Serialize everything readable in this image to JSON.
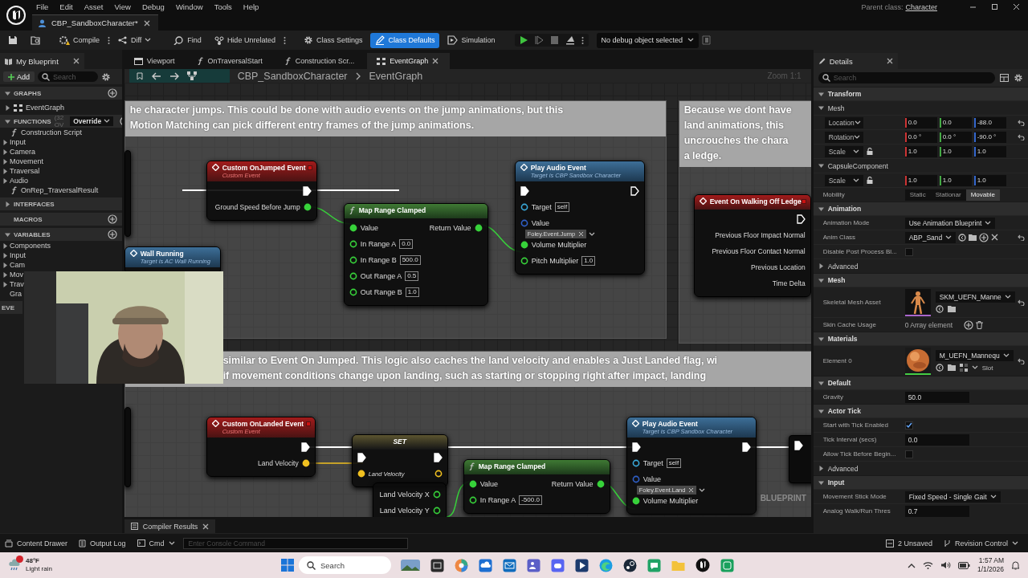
{
  "menu_bar": {
    "menus": [
      "File",
      "Edit",
      "Asset",
      "View",
      "Debug",
      "Window",
      "Tools",
      "Help"
    ],
    "parent_class_label": "Parent class:",
    "parent_class": "Character"
  },
  "document_tabs": [
    {
      "label": "CBP_SandboxCharacter*",
      "selected": true
    }
  ],
  "toolbar": {
    "buttons": [
      {
        "label": "Compile",
        "kind": "compile",
        "selected": false
      },
      {
        "label": "Diff",
        "kind": "diff",
        "selected": false
      },
      {
        "label": "Find",
        "kind": "find",
        "selected": false
      },
      {
        "label": "Hide Unrelated",
        "kind": "hide",
        "selected": false
      },
      {
        "label": "Class Settings",
        "kind": "settings",
        "selected": false
      },
      {
        "label": "Class Defaults",
        "kind": "defaults",
        "selected": true
      },
      {
        "label": "Simulation",
        "kind": "simulation",
        "selected": false
      }
    ],
    "debug_object": "No debug object selected"
  },
  "my_blueprint": {
    "tab": "My Blueprint",
    "add": "Add",
    "search_placeholder": "Search",
    "sections": [
      {
        "title": "GRAPHS",
        "expanded": true,
        "add": true,
        "items": [
          {
            "label": "EventGraph",
            "kind": "graph"
          }
        ]
      },
      {
        "title": "FUNCTIONS",
        "count": "(32 OV",
        "override": "Override",
        "expanded": true,
        "add": true,
        "items": [
          {
            "label": "Construction Script",
            "kind": "function"
          },
          {
            "label": "Input",
            "kind": "category"
          },
          {
            "label": "Camera",
            "kind": "category"
          },
          {
            "label": "Movement",
            "kind": "category"
          },
          {
            "label": "Traversal",
            "kind": "category"
          },
          {
            "label": "Audio",
            "kind": "category"
          },
          {
            "label": "OnRep_TraversalResult",
            "kind": "function"
          }
        ]
      },
      {
        "title": "INTERFACES",
        "expanded": false,
        "add": false
      },
      {
        "title": "MACROS",
        "add": true
      },
      {
        "title": "VARIABLES",
        "expanded": true,
        "add": true,
        "items": [
          {
            "label": "Components",
            "kind": "category"
          },
          {
            "label": "Input",
            "kind": "category"
          },
          {
            "label": "Cam",
            "kind": "category"
          },
          {
            "label": "Mov",
            "kind": "category"
          },
          {
            "label": "Trav",
            "kind": "category"
          },
          {
            "label": "Gra",
            "kind": "plain"
          }
        ]
      },
      {
        "title": "EVE",
        "add": false
      }
    ]
  },
  "graph": {
    "tabs": [
      {
        "label": "Viewport",
        "kind": "viewport",
        "selected": false
      },
      {
        "label": "OnTraversalStart",
        "kind": "function",
        "selected": false
      },
      {
        "label": "Construction Scr...",
        "kind": "function",
        "selected": false
      },
      {
        "label": "EventGraph",
        "kind": "graph",
        "selected": true
      }
    ],
    "breadcrumb": [
      "CBP_SandboxCharacter",
      "EventGraph"
    ],
    "zoom": "Zoom 1:1",
    "watermark": "BLUEPRINT",
    "comments": [
      {
        "lines": [
          "he character jumps. This could be done with audio events on the jump animations, but this",
          "Motion Matching can pick different entry frames of the jump animations."
        ]
      },
      {
        "lines": [
          "Because we dont have",
          "land animations, this",
          "uncrouches the chara",
          "a ledge."
        ]
      },
      {
        "lines": [
          "similar to Event On Jumped. This logic also caches the land velocity and enables a Just Landed flag, wi",
          "if movement conditions change upon landing, such as starting or stopping right after impact, landing"
        ]
      }
    ],
    "nodes": [
      {
        "title": "Custom OnJumped Event",
        "subtitle": "Custom Event",
        "kind": "event",
        "rows": [
          {
            "right": {
              "kind": "exec",
              "connected": true
            }
          },
          {
            "right": {
              "kind": "data",
              "label": "Ground Speed Before Jump",
              "color": "#37d23a",
              "connected": true
            }
          }
        ]
      },
      {
        "title": "Map Range Clamped",
        "kind": "function",
        "rows": [
          {
            "left": {
              "kind": "data",
              "label": "Value",
              "color": "#37d23a",
              "connected": true
            },
            "right": {
              "kind": "data",
              "label": "Return Value",
              "color": "#37d23a",
              "connected": true
            }
          },
          {
            "left": {
              "kind": "data",
              "label": "In Range A",
              "value": "0.0",
              "color": "#37d23a",
              "connected": false
            }
          },
          {
            "left": {
              "kind": "data",
              "label": "In Range B",
              "value": "500.0",
              "color": "#37d23a",
              "connected": false
            }
          },
          {
            "left": {
              "kind": "data",
              "label": "Out Range A",
              "value": "0.5",
              "color": "#37d23a",
              "connected": false
            }
          },
          {
            "left": {
              "kind": "data",
              "label": "Out Range B",
              "value": "1.0",
              "color": "#37d23a",
              "connected": false
            }
          }
        ]
      },
      {
        "title": "Play Audio Event",
        "subtitle": "Target is CBP Sandbox Character",
        "kind": "call",
        "rows": [
          {
            "left": {
              "kind": "exec",
              "connected": true
            },
            "right": {
              "kind": "exec",
              "connected": false
            }
          },
          {
            "left": {
              "kind": "data",
              "label": "Target",
              "value": "self",
              "color": "#3aa8d8",
              "connected": false
            }
          },
          {
            "left": {
              "kind": "data",
              "label": "Value",
              "tag": "Foley.Event.Jump",
              "color": "#2f5fc8",
              "connected": false
            }
          },
          {
            "left": {
              "kind": "data",
              "label": "Volume Multiplier",
              "color": "#37d23a",
              "connected": true
            }
          },
          {
            "left": {
              "kind": "data",
              "label": "Pitch Multiplier",
              "value": "1.0",
              "color": "#37d23a",
              "connected": false
            }
          }
        ]
      },
      {
        "title": "Event On Walking Off Ledge",
        "kind": "event",
        "rows": [
          {
            "right": {
              "kind": "exec"
            }
          },
          {
            "right": {
              "kind": "data",
              "label": "Previous Floor Impact Normal"
            }
          },
          {
            "right": {
              "kind": "data",
              "label": "Previous Floor Contact Normal"
            }
          },
          {
            "right": {
              "kind": "data",
              "label": "Previous Location"
            }
          },
          {
            "right": {
              "kind": "data",
              "label": "Time Delta"
            }
          }
        ]
      },
      {
        "title": "Wall Running",
        "subtitle": "Target is AC Wall Running",
        "kind": "call"
      },
      {
        "title": "Custom OnLanded Event",
        "subtitle": "Custom Event",
        "kind": "event",
        "rows": [
          {
            "right": {
              "kind": "exec",
              "connected": true
            }
          },
          {
            "right": {
              "kind": "data",
              "label": "Land Velocity",
              "color": "#f0c020",
              "connected": true
            }
          }
        ]
      },
      {
        "title": "SET",
        "kind": "set",
        "rows": [
          {
            "left": {
              "kind": "exec",
              "connected": true
            },
            "right": {
              "kind": "exec",
              "connected": true
            }
          },
          {
            "left": {
              "kind": "data",
              "label": "Land Velocity",
              "color": "#f0c020",
              "connected": true
            },
            "right": {
              "kind": "data",
              "color": "#f0c020",
              "connected": false
            }
          }
        ]
      },
      {
        "kind": "pure",
        "rows": [
          {
            "right": {
              "kind": "data",
              "label": "Land Velocity X",
              "color": "#37d23a",
              "connected": false
            }
          },
          {
            "right": {
              "kind": "data",
              "label": "Land Velocity Y",
              "color": "#37d23a",
              "connected": false
            }
          }
        ]
      },
      {
        "title": "Map Range Clamped",
        "kind": "function",
        "rows": [
          {
            "left": {
              "kind": "data",
              "label": "Value",
              "color": "#37d23a",
              "connected": true
            },
            "right": {
              "kind": "data",
              "label": "Return Value",
              "color": "#37d23a",
              "connected": true
            }
          },
          {
            "left": {
              "kind": "data",
              "label": "In Range A",
              "value": "-500.0",
              "color": "#37d23a",
              "connected": false
            }
          }
        ]
      },
      {
        "title": "Play Audio Event",
        "subtitle": "Target is CBP Sandbox Character",
        "kind": "call",
        "rows": [
          {
            "left": {
              "kind": "exec",
              "connected": true
            },
            "right": {
              "kind": "exec",
              "connected": true
            }
          },
          {
            "left": {
              "kind": "data",
              "label": "Target",
              "value": "self",
              "color": "#3aa8d8",
              "connected": false
            }
          },
          {
            "left": {
              "kind": "data",
              "label": "Value",
              "tag": "Foley.Event.Land",
              "color": "#2f5fc8",
              "connected": false
            }
          },
          {
            "left": {
              "kind": "data",
              "label": "Volume Multiplier",
              "color": "#37d23a",
              "connected": true
            }
          }
        ]
      },
      {
        "kind": "partial"
      },
      {
        "kind": "partial"
      },
      {
        "kind": "partial",
        "rows": [
          {
            "left": {
              "kind": "exec",
              "connected": true
            }
          }
        ]
      }
    ]
  },
  "details": {
    "tab": "Details",
    "search_placeholder": "Search",
    "sections": [
      {
        "title": "Transform",
        "expanded": true,
        "rows": [
          {
            "kind": "group",
            "label": "Mesh",
            "expanded": true
          },
          {
            "kind": "vector",
            "label": "Location",
            "values": [
              "0.0",
              "0.0",
              "-88.0"
            ],
            "reset": true
          },
          {
            "kind": "vector",
            "label": "Rotation",
            "values": [
              "0.0 °",
              "0.0 °",
              "-90.0 °"
            ],
            "reset": true
          },
          {
            "kind": "scale",
            "label": "Scale",
            "values": [
              "1.0",
              "1.0",
              "1.0"
            ],
            "reset": false
          },
          {
            "kind": "group",
            "label": "CapsuleComponent",
            "expanded": true
          },
          {
            "kind": "scale",
            "label": "Scale",
            "values": [
              "1.0",
              "1.0",
              "1.0"
            ],
            "reset": false
          },
          {
            "kind": "segmented",
            "label": "Mobility",
            "options": [
              {
                "label": "Static",
                "selected": false
              },
              {
                "label": "Stationar",
                "selected": false
              },
              {
                "label": "Movable",
                "selected": true
              }
            ]
          }
        ]
      },
      {
        "title": "Animation",
        "expanded": true,
        "rows": [
          {
            "kind": "dropdown",
            "label": "Animation Mode",
            "value": "Use Animation Blueprint"
          },
          {
            "kind": "asset",
            "label": "Anim Class",
            "value": "ABP_Sand",
            "reset": true
          },
          {
            "kind": "checkbox",
            "label": "Disable Post Process Bl...",
            "checked": false
          },
          {
            "kind": "group",
            "label": "Advanced",
            "expanded": false
          }
        ]
      },
      {
        "title": "Mesh",
        "expanded": true,
        "rows": [
          {
            "kind": "thumbnail",
            "label": "Skeletal Mesh Asset",
            "value": "SKM_UEFN_Manne",
            "reset": true
          },
          {
            "kind": "array",
            "label": "Skin Cache Usage",
            "value": "0 Array element"
          }
        ]
      },
      {
        "title": "Materials",
        "expanded": true,
        "rows": [
          {
            "kind": "material",
            "label": "Element 0",
            "value": "M_UEFN_Mannequ",
            "slot": "Slot",
            "reset": true
          }
        ]
      },
      {
        "title": "Default",
        "expanded": true,
        "rows": [
          {
            "kind": "number",
            "label": "Gravity",
            "value": "50.0"
          }
        ]
      },
      {
        "title": "Actor Tick",
        "expanded": true,
        "rows": [
          {
            "kind": "checkbox",
            "label": "Start with Tick Enabled",
            "checked": true
          },
          {
            "kind": "number",
            "label": "Tick Interval (secs)",
            "value": "0.0"
          },
          {
            "kind": "checkbox",
            "label": "Allow Tick Before Begin...",
            "checked": false
          },
          {
            "kind": "group",
            "label": "Advanced",
            "expanded": false
          }
        ]
      },
      {
        "title": "Input",
        "expanded": true,
        "rows": [
          {
            "kind": "dropdown",
            "label": "Movement Stick Mode",
            "value": "Fixed Speed - Single Gait"
          },
          {
            "kind": "number",
            "label": "Analog Walk/Run Thres",
            "value": "0.7"
          }
        ]
      }
    ]
  },
  "bottom_tabs": [
    {
      "label": "Compiler Results",
      "selected": true
    }
  ],
  "status_bar": {
    "content_drawer": "Content Drawer",
    "output_log": "Output Log",
    "cmd": "Cmd",
    "console_placeholder": "Enter Console Command",
    "unsaved": "2 Unsaved",
    "revision": "Revision Control"
  },
  "taskbar": {
    "temperature": "48°F",
    "weather": "Light rain",
    "search_placeholder": "Search",
    "time": "1:57 AM",
    "date": "1/1/2026"
  }
}
